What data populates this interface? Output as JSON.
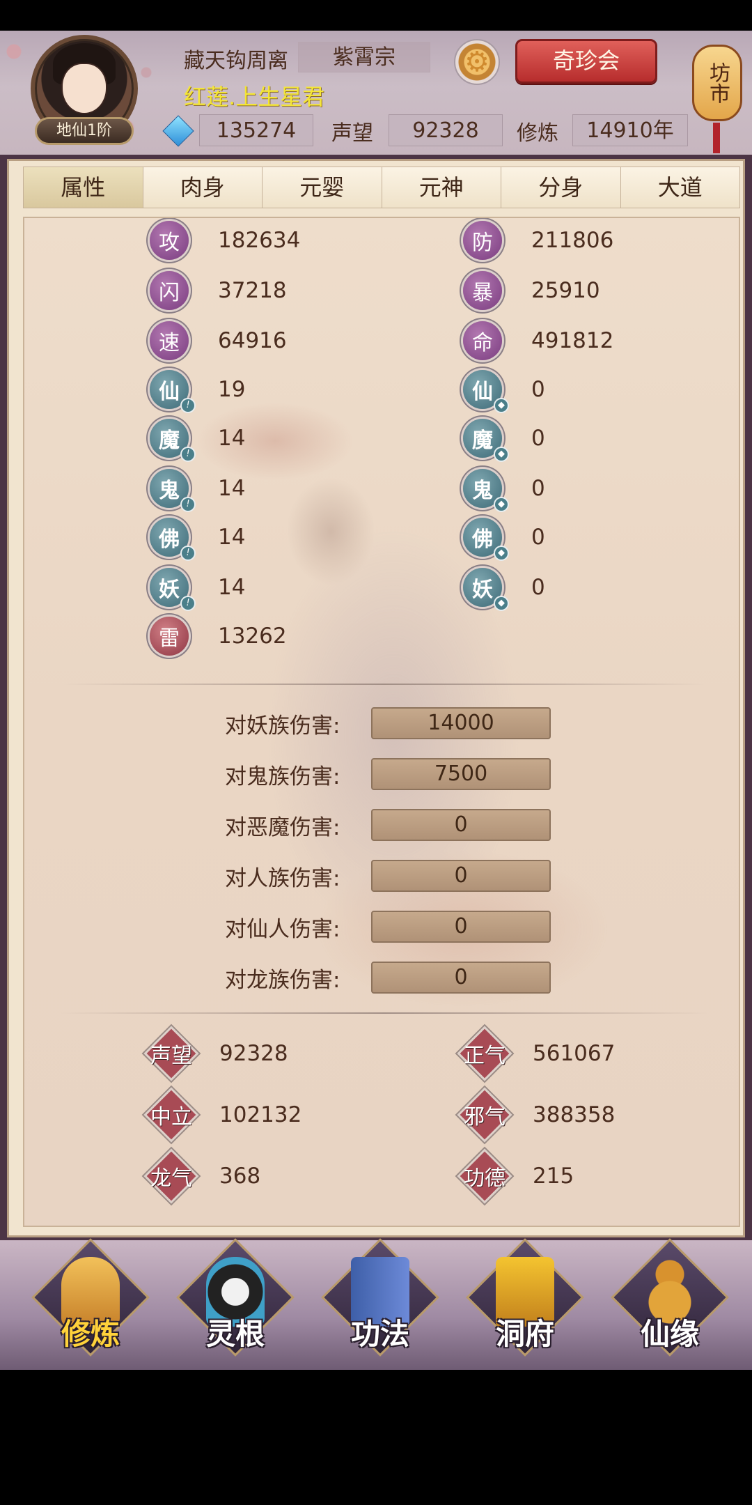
{
  "header": {
    "player_name": "藏天钩周离",
    "sect": "紫霄宗",
    "title": "红莲.上生星君",
    "rank": "地仙1阶",
    "treasure_button": "奇珍会",
    "market_label": "坊市",
    "gems": "135274",
    "reputation_label": "声望",
    "reputation": "92328",
    "cultivation_label": "修炼",
    "cultivation": "14910年"
  },
  "tabs": [
    "属性",
    "肉身",
    "元婴",
    "元神",
    "分身",
    "大道"
  ],
  "stats_left": [
    {
      "icon": "攻",
      "value": "182634"
    },
    {
      "icon": "闪",
      "value": "37218"
    },
    {
      "icon": "速",
      "value": "64916"
    },
    {
      "icon": "仙",
      "value": "19"
    },
    {
      "icon": "魔",
      "value": "14"
    },
    {
      "icon": "鬼",
      "value": "14"
    },
    {
      "icon": "佛",
      "value": "14"
    },
    {
      "icon": "妖",
      "value": "14"
    },
    {
      "icon": "雷",
      "value": "13262"
    }
  ],
  "stats_right": [
    {
      "icon": "防",
      "value": "211806"
    },
    {
      "icon": "暴",
      "value": "25910"
    },
    {
      "icon": "命",
      "value": "491812"
    },
    {
      "icon": "仙",
      "value": "0"
    },
    {
      "icon": "魔",
      "value": "0"
    },
    {
      "icon": "鬼",
      "value": "0"
    },
    {
      "icon": "佛",
      "value": "0"
    },
    {
      "icon": "妖",
      "value": "0"
    }
  ],
  "damage": [
    {
      "label": "对妖族伤害:",
      "value": "14000"
    },
    {
      "label": "对鬼族伤害:",
      "value": "7500"
    },
    {
      "label": "对恶魔伤害:",
      "value": "0"
    },
    {
      "label": "对人族伤害:",
      "value": "0"
    },
    {
      "label": "对仙人伤害:",
      "value": "0"
    },
    {
      "label": "对龙族伤害:",
      "value": "0"
    }
  ],
  "reputation_stats": [
    {
      "label": "声望",
      "value": "92328"
    },
    {
      "label": "正气",
      "value": "561067"
    },
    {
      "label": "中立",
      "value": "102132"
    },
    {
      "label": "邪气",
      "value": "388358"
    },
    {
      "label": "龙气",
      "value": "368"
    },
    {
      "label": "功德",
      "value": "215"
    }
  ],
  "nav": [
    "修炼",
    "灵根",
    "功法",
    "洞府",
    "仙缘"
  ]
}
